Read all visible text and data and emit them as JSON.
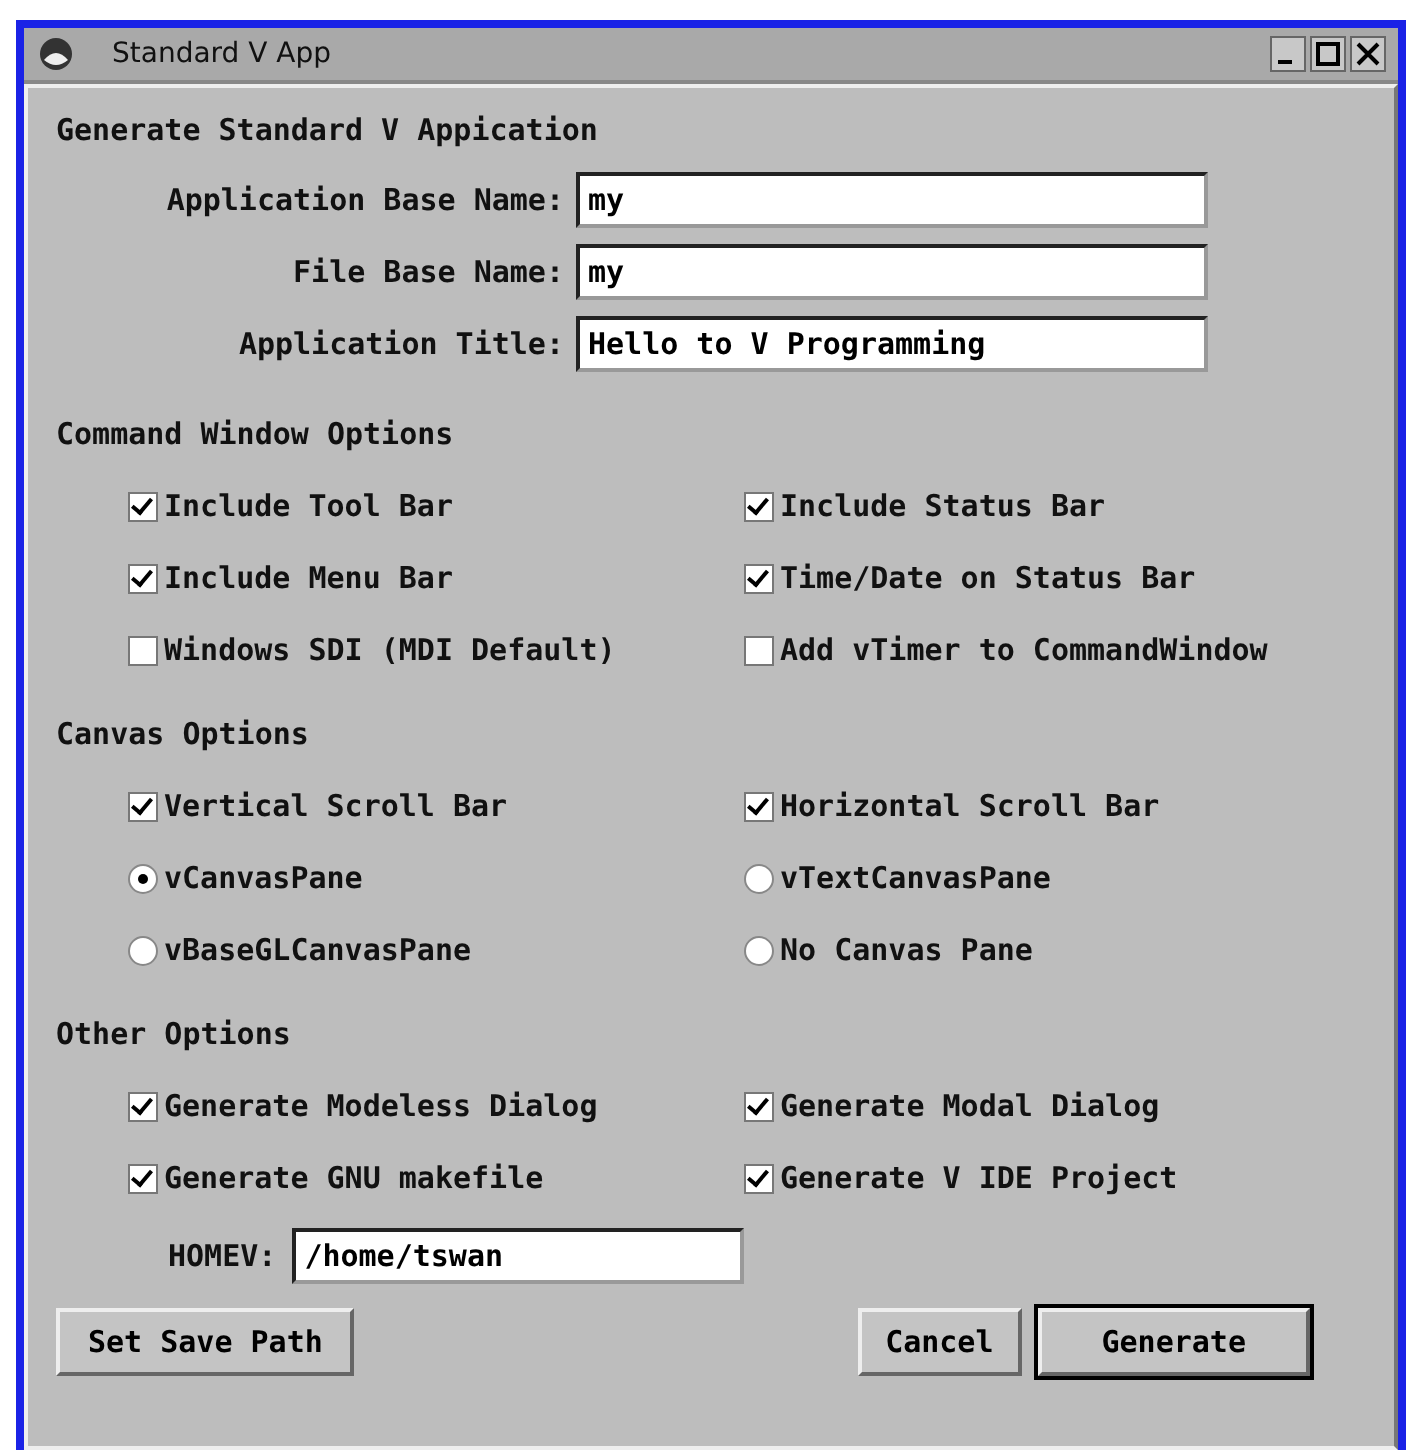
{
  "window": {
    "title": "Standard V App"
  },
  "heading": "Generate Standard V Appication",
  "fields": [
    {
      "label": "Application Base Name:",
      "value": "my"
    },
    {
      "label": "File Base Name:",
      "value": "my"
    },
    {
      "label": "Application Title:",
      "value": "Hello to V Programming"
    }
  ],
  "sections": [
    {
      "title": "Command Window Options",
      "options": [
        {
          "kind": "checkbox",
          "label": "Include Tool Bar",
          "checked": true
        },
        {
          "kind": "checkbox",
          "label": "Include Status Bar",
          "checked": true
        },
        {
          "kind": "checkbox",
          "label": "Include Menu Bar",
          "checked": true
        },
        {
          "kind": "checkbox",
          "label": "Time/Date on Status Bar",
          "checked": true
        },
        {
          "kind": "checkbox",
          "label": "Windows SDI (MDI Default)",
          "checked": false
        },
        {
          "kind": "checkbox",
          "label": "Add vTimer to CommandWindow",
          "checked": false
        }
      ]
    },
    {
      "title": "Canvas Options",
      "options": [
        {
          "kind": "checkbox",
          "label": "Vertical Scroll Bar",
          "checked": true
        },
        {
          "kind": "checkbox",
          "label": "Horizontal Scroll Bar",
          "checked": true
        },
        {
          "kind": "radio",
          "label": "vCanvasPane",
          "selected": true
        },
        {
          "kind": "radio",
          "label": "vTextCanvasPane",
          "selected": false
        },
        {
          "kind": "radio",
          "label": "vBaseGLCanvasPane",
          "selected": false
        },
        {
          "kind": "radio",
          "label": "No Canvas Pane",
          "selected": false
        }
      ]
    },
    {
      "title": "Other Options",
      "options": [
        {
          "kind": "checkbox",
          "label": "Generate Modeless Dialog",
          "checked": true
        },
        {
          "kind": "checkbox",
          "label": "Generate Modal Dialog",
          "checked": true
        },
        {
          "kind": "checkbox",
          "label": "Generate GNU makefile",
          "checked": true
        },
        {
          "kind": "checkbox",
          "label": "Generate V IDE Project",
          "checked": true
        }
      ],
      "field": {
        "label": "HOMEV:",
        "value": "/home/tswan"
      }
    }
  ],
  "buttons": [
    {
      "label": "Set Save Path",
      "default": false
    },
    {
      "label": "Cancel",
      "default": false
    },
    {
      "label": "Generate",
      "default": true
    }
  ]
}
